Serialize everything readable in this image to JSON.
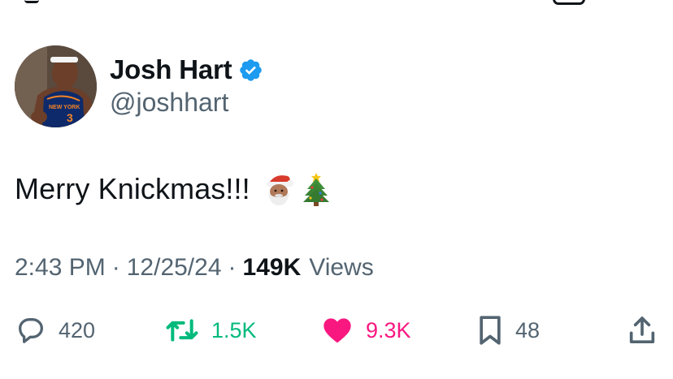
{
  "tweet": {
    "author": {
      "name": "Josh Hart",
      "handle": "@joshhart",
      "verified": true,
      "avatar_jersey_text": "NEW YORK",
      "avatar_jersey_number": "3"
    },
    "text": "Merry Knickmas!!!",
    "emojis": [
      "santa-emoji",
      "christmas-tree-emoji"
    ],
    "time": "2:43 PM",
    "date": "12/25/24",
    "separator": "·",
    "views_count": "149K",
    "views_label": "Views"
  },
  "actions": {
    "replies": "420",
    "retweets": "1.5K",
    "likes": "9.3K",
    "bookmarks": "48"
  },
  "colors": {
    "text_primary": "#0f1419",
    "text_secondary": "#536471",
    "verified_blue": "#1d9bf0",
    "retweet_green": "#00ba7c",
    "like_pink": "#f91880"
  },
  "icons": {
    "reply": "speech-bubble-icon",
    "retweet": "retweet-arrows-icon",
    "like": "heart-filled-icon",
    "bookmark": "bookmark-icon",
    "share": "share-upload-icon",
    "verified": "verified-badge-icon"
  }
}
